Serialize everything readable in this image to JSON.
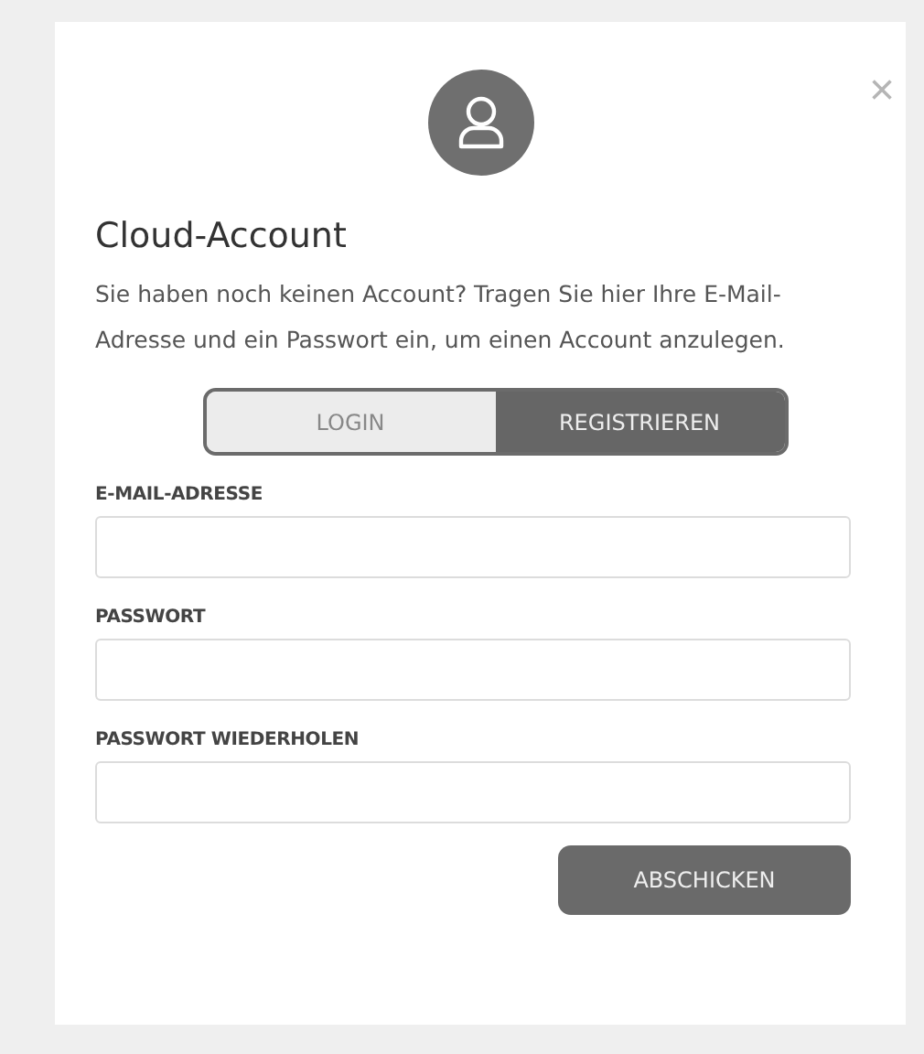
{
  "dialog": {
    "close": "×",
    "title": "Cloud-Account",
    "text": "Sie haben noch keinen Account? Tragen Sie hier Ihre E-Mail-Adresse und ein Passwort ein, um einen Account anzulegen."
  },
  "tabs": [
    {
      "label": "LOGIN",
      "selected": false
    },
    {
      "label": "REGISTRIEREN",
      "selected": true
    }
  ],
  "fields": [
    {
      "label": "E-MAIL-ADRESSE"
    },
    {
      "label": "PASSWORT"
    },
    {
      "label": "PASSWORT WIEDERHOLEN"
    }
  ],
  "submit": "ABSCHICKEN"
}
